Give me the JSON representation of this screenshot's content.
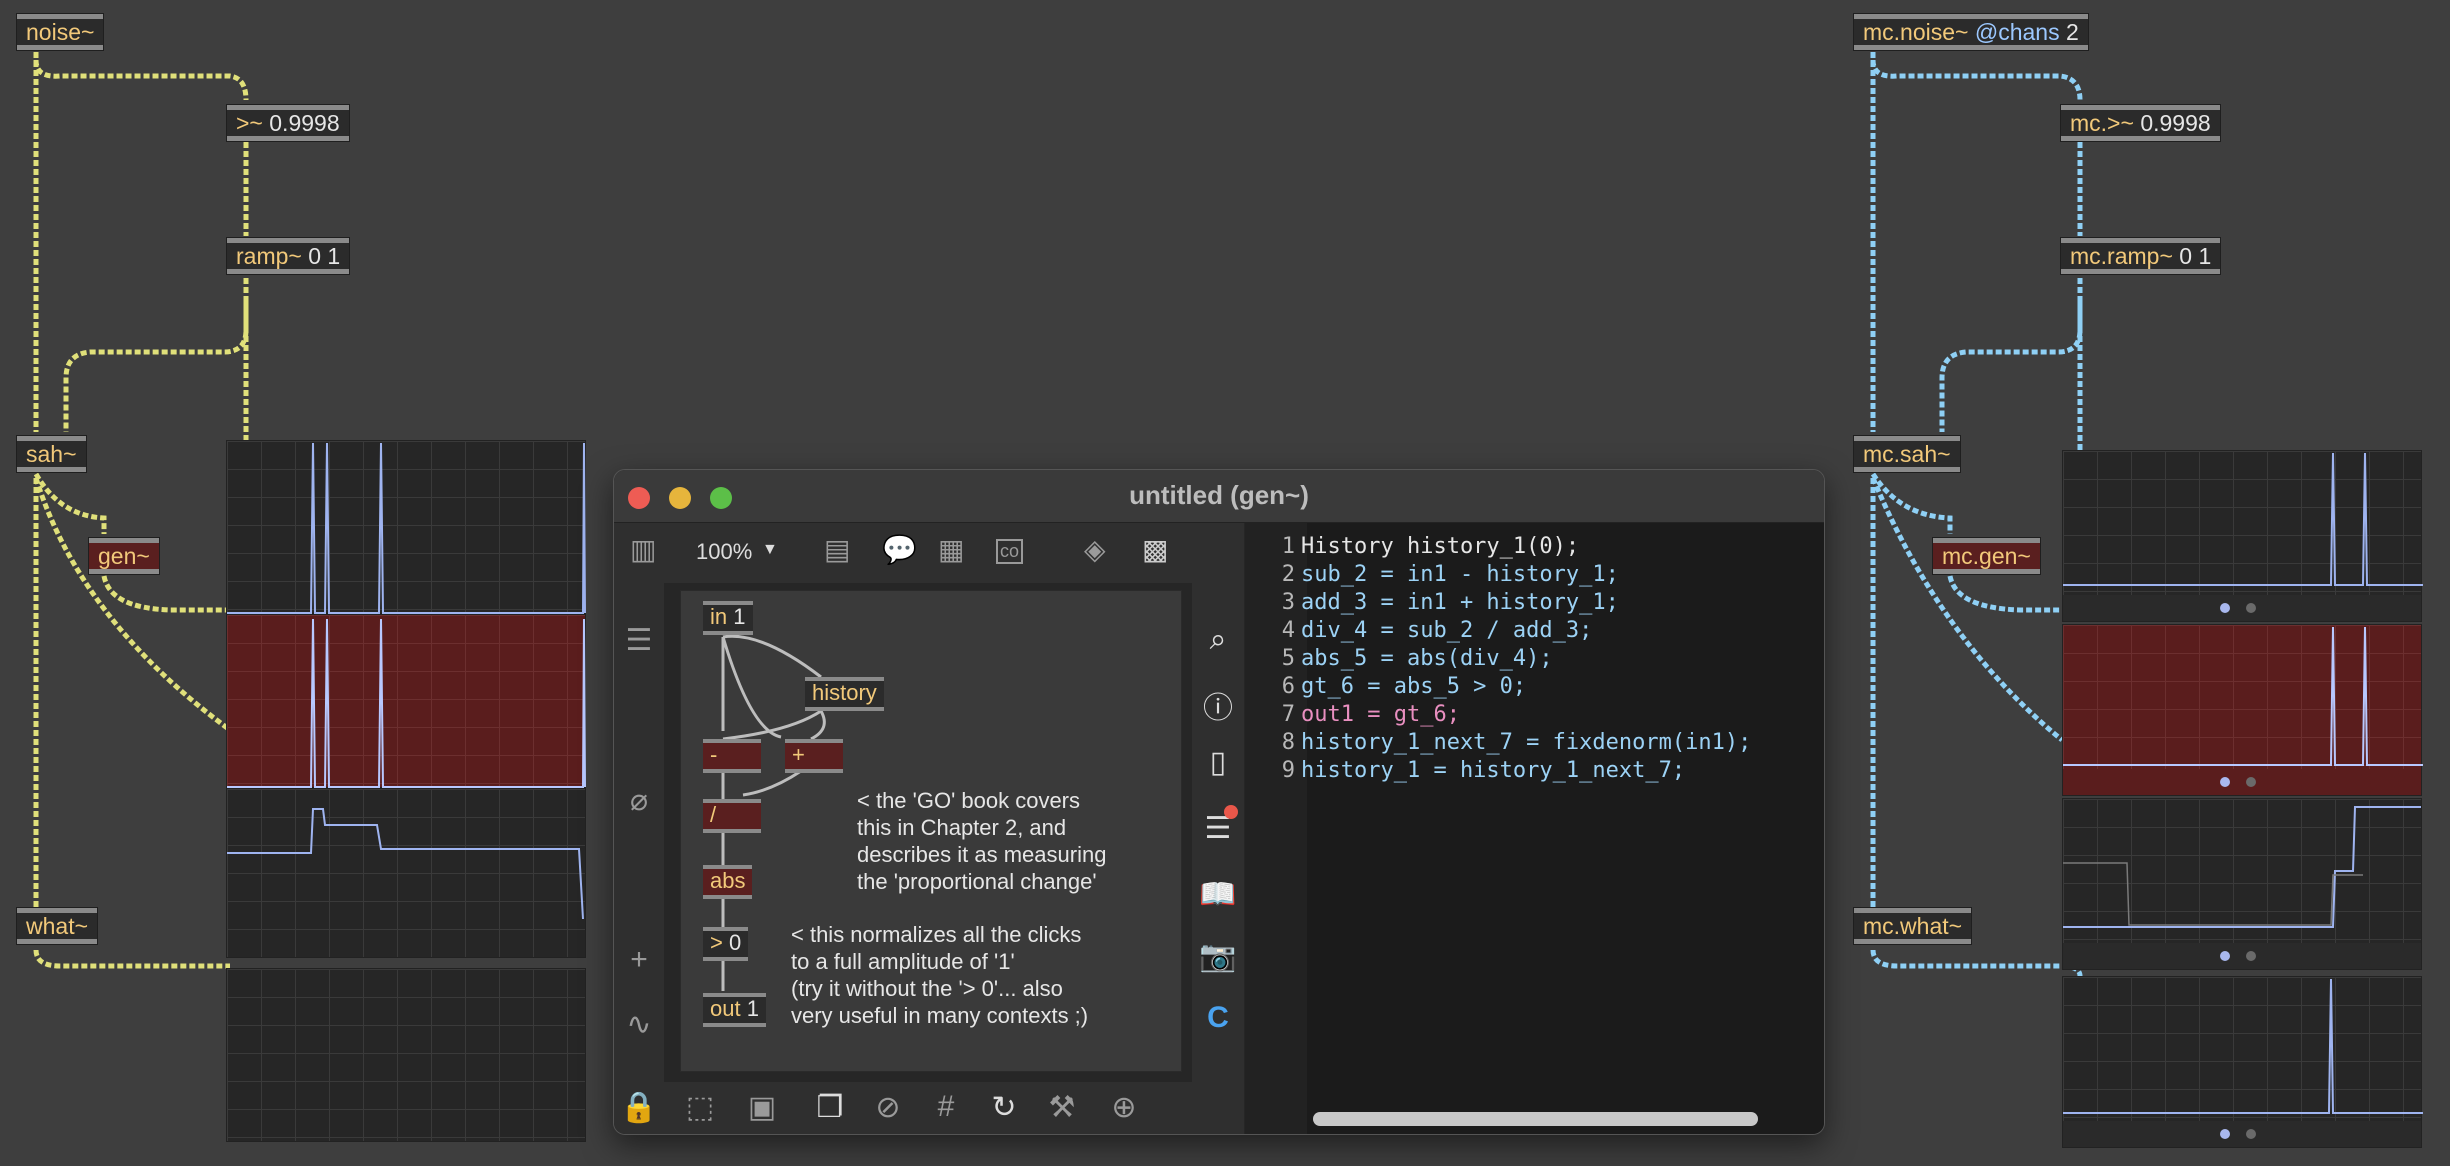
{
  "left_patch": {
    "noise": {
      "name": "noise~"
    },
    "threshold": {
      "name": ">~",
      "args": "0.9998"
    },
    "ramp": {
      "name": "ramp~",
      "args": "0 1"
    },
    "sah": {
      "name": "sah~"
    },
    "gen": {
      "name": "gen~"
    },
    "what": {
      "name": "what~"
    }
  },
  "right_patch": {
    "noise": {
      "name": "mc.noise~",
      "attr": "@chans",
      "args": "2"
    },
    "threshold": {
      "name": "mc.>~",
      "args": "0.9998"
    },
    "ramp": {
      "name": "mc.ramp~",
      "args": "0 1"
    },
    "sah": {
      "name": "mc.sah~"
    },
    "gen": {
      "name": "mc.gen~"
    },
    "what": {
      "name": "mc.what~"
    }
  },
  "gen_window": {
    "title": "untitled (gen~)",
    "zoom": "100%",
    "objects": {
      "in": {
        "name": "in",
        "args": "1"
      },
      "history": {
        "name": "history"
      },
      "minus": {
        "name": "-"
      },
      "plus": {
        "name": "+"
      },
      "div": {
        "name": "/"
      },
      "abs": {
        "name": "abs"
      },
      "gt": {
        "name": ">",
        "args": "0"
      },
      "out": {
        "name": "out",
        "args": "1"
      }
    },
    "comments": {
      "go_book": "< the 'GO' book covers\nthis in Chapter 2, and\ndescribes it as measuring\nthe 'proportional change'",
      "normalize": "< this normalizes all the clicks\nto a full amplitude of '1'\n(try it without the '> 0'... also\nvery useful in many contexts ;)"
    },
    "code_lines": [
      "History history_1(0);",
      "sub_2 = in1 - history_1;",
      "add_3 = in1 + history_1;",
      "div_4 = sub_2 / add_3;",
      "abs_5 = abs(div_4);",
      "gt_6 = abs_5 > 0;",
      "out1 = gt_6;",
      "history_1_next_7 = fixdenorm(in1);",
      "history_1 = history_1_next_7;"
    ],
    "line_numbers": [
      "1",
      "2",
      "3",
      "4",
      "5",
      "6",
      "7",
      "8",
      "9"
    ]
  },
  "colors": {
    "signal_patchcord": "#e0e07a",
    "mc_patchcord": "#8fd0f5",
    "trace": "#9fb4f0",
    "gen_red": "#5a1f1f"
  },
  "icons": {
    "toolbar": [
      "sidebar-icon",
      "zoom-dropdown-icon",
      "presentation-icon",
      "comment-icon",
      "frame-icon",
      "codebox-icon",
      "paint-bucket-icon",
      "grid-keyboard-icon"
    ],
    "right_sidebar": [
      "search-icon",
      "info-icon",
      "reference-icon",
      "console-icon",
      "book-icon",
      "snapshot-icon",
      "c-icon"
    ],
    "bottom": [
      "lock-icon",
      "edit-icon",
      "presentation-mode-icon",
      "layers-icon",
      "hide-icon",
      "grid-icon",
      "refresh-icon",
      "hammer-icon",
      "attach-icon"
    ]
  }
}
